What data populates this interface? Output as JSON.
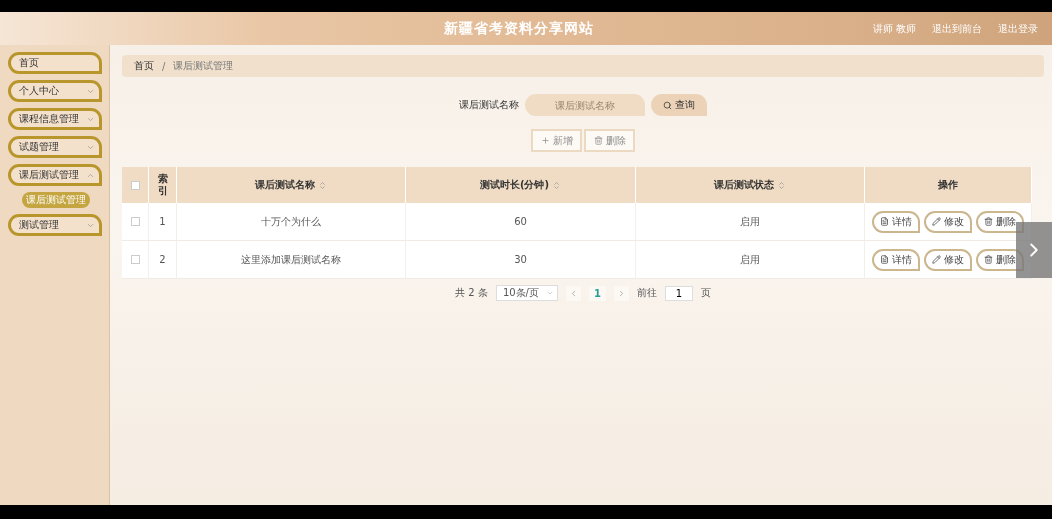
{
  "header": {
    "title": "新疆省考资料分享网站",
    "user": "讲师 教师",
    "links": [
      "退出到前台",
      "退出登录"
    ]
  },
  "sidebar": {
    "items": [
      {
        "label": "首页",
        "expandable": false
      },
      {
        "label": "个人中心",
        "expandable": true,
        "expanded": false
      },
      {
        "label": "课程信息管理",
        "expandable": true,
        "expanded": false
      },
      {
        "label": "试题管理",
        "expandable": true,
        "expanded": false
      },
      {
        "label": "课后测试管理",
        "expandable": true,
        "expanded": true,
        "children": [
          {
            "label": "课后测试管理",
            "selected": true
          }
        ]
      },
      {
        "label": "测试管理",
        "expandable": true,
        "expanded": false
      }
    ]
  },
  "breadcrumb": [
    "首页",
    "/",
    "课后测试管理"
  ],
  "search": {
    "label": "课后测试名称",
    "placeholder": "课后测试名称",
    "button": "查询"
  },
  "actions": [
    {
      "kind": "add",
      "label": "新增",
      "disabled": true
    },
    {
      "kind": "delete",
      "label": "删除",
      "disabled": true
    }
  ],
  "table": {
    "select_all_checked": false,
    "columns": [
      {
        "label": "索引",
        "sortable": false
      },
      {
        "label": "课后测试名称",
        "sortable": true
      },
      {
        "label": "测试时长(分钟)",
        "sortable": true
      },
      {
        "label": "课后测试状态",
        "sortable": true
      },
      {
        "label": "操作",
        "sortable": false
      }
    ],
    "rows": [
      {
        "checked": false,
        "cells": [
          "1",
          "十万个为什么",
          "60",
          "启用"
        ],
        "actions": [
          {
            "kind": "detail",
            "label": "详情"
          },
          {
            "kind": "edit",
            "label": "修改"
          },
          {
            "kind": "delete",
            "label": "删除"
          }
        ]
      },
      {
        "checked": false,
        "cells": [
          "2",
          "这里添加课后测试名称",
          "30",
          "启用"
        ],
        "actions": [
          {
            "kind": "detail",
            "label": "详情"
          },
          {
            "kind": "edit",
            "label": "修改"
          },
          {
            "kind": "delete",
            "label": "删除"
          }
        ]
      }
    ]
  },
  "pagination": {
    "total": "共 2 条",
    "page_size": "10条/页",
    "pages": [
      {
        "label": "1",
        "selected": true
      }
    ],
    "goto": "前往",
    "page_input": "1",
    "page_unit": "页"
  }
}
